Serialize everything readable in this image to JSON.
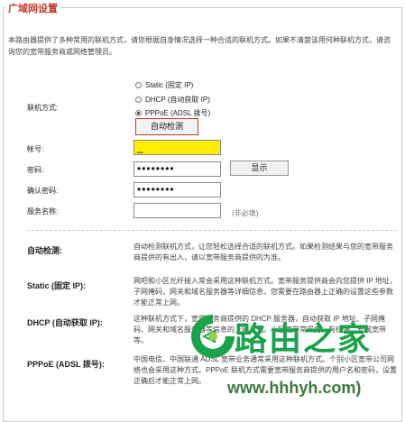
{
  "section_title": "广域网设置",
  "intro": "本路由器提供了多种常用的联机方式，请您根据自身情况选择一种合适的联机方式。如果不清楚该用何种联机方式，请咨询您的宽带服务商或网络管理员。",
  "connection": {
    "label": "联机方式:",
    "options": [
      {
        "label": "Static (固定 IP)",
        "checked": false
      },
      {
        "label": "DHCP (自动获取 IP)",
        "checked": false
      },
      {
        "label": "PPPoE (ADSL 拨号)",
        "checked": true
      }
    ],
    "detect_button": "自动检测"
  },
  "account": {
    "label": "帐号:",
    "value": "_"
  },
  "password": {
    "label": "密码:",
    "value": "••••••••",
    "show_button": "显示"
  },
  "confirm_password": {
    "label": "确认密码:",
    "value": "••••••••"
  },
  "service_name": {
    "label": "服务名称:",
    "value": "",
    "hint": "(非必填)"
  },
  "help": [
    {
      "label": "自动检测:",
      "text": "自动检测联机方式，让您轻松选择合适的联机方式。如果检测结果与您的宽带服务商提供的有出入，请以宽带服务商提供的为准。"
    },
    {
      "label": "Static (固定 IP):",
      "text": "网吧和小区光纤接入常会采用这种联机方式。宽带服务提供商会向您提供 IP 地址，子网掩码，网关和域名服务器等详细信息，您需要在路由器上正确的设置这些参数才能正常上网。"
    },
    {
      "label": "DHCP (自动获取 IP):",
      "text": "这种联机方式下，宽带服务商提供的 DHCP 服务器，自动获取 IP 地址、子网掩码、网关和域名服务器等信息的上网方式。小区宽带常采用，有线通、长城宽带等。"
    },
    {
      "label": "PPPoE (ADSL 拨号):",
      "text": "中国电信、中国联通 ADSL 宽带业务通常采用这种联机方式。个别小区宽带公司网络也会采用这种方式。PPPoE 联机方式需要宽带服务商提供的用户名和密码，设置正确后才能正常上网。"
    }
  ],
  "watermark": {
    "name": "路由之家",
    "url": "www.hhhyh.com)"
  },
  "colors": {
    "title": "#c0392b",
    "highlight": "#ffee00",
    "brand_green": "#1aa34a"
  }
}
